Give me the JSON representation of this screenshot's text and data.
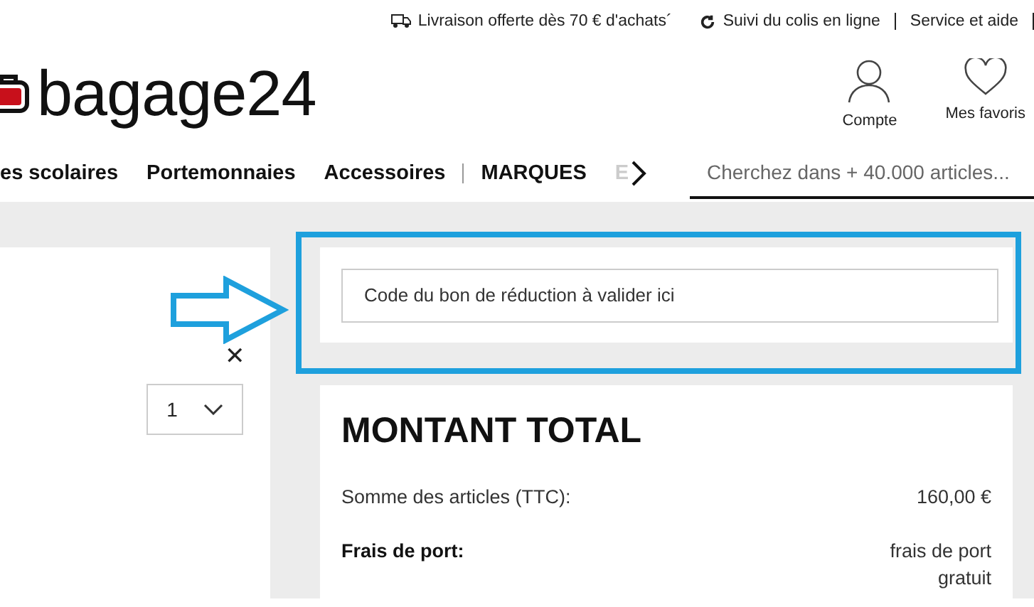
{
  "top_bar": {
    "links": [
      {
        "kind": "truck",
        "label": "Livraison offerte dès 70 € d'achats´"
      },
      {
        "kind": "refresh",
        "label": "Suivi du colis en ligne"
      },
      {
        "kind": "plain",
        "label": "Service et aide"
      }
    ]
  },
  "header": {
    "logo": "bagage24",
    "actions": [
      {
        "kind": "person",
        "label": "Compte"
      },
      {
        "kind": "heart",
        "label": "Mes favoris"
      }
    ]
  },
  "nav": {
    "items": [
      {
        "label": "es scolaires",
        "faded": false
      },
      {
        "label": "Portemonnaies",
        "faded": false
      },
      {
        "label": "Accessoires",
        "faded": false
      },
      {
        "label": "MARQUES",
        "faded": false
      },
      {
        "label": "E",
        "faded": true
      }
    ],
    "search": {
      "placeholder": "Cherchez dans + 40.000 articles..."
    }
  },
  "cart_item": {
    "remove": "✕",
    "quantity": "1"
  },
  "voucher": {
    "placeholder": "Code du bon de réduction à valider ici"
  },
  "total": {
    "title": "MONTANT TOTAL",
    "rows": [
      {
        "label": "Somme des articles (TTC):",
        "value": "160,00 €",
        "bold": false
      },
      {
        "label": "Frais de port:",
        "value": "frais de port gratuit",
        "bold": true
      }
    ]
  }
}
